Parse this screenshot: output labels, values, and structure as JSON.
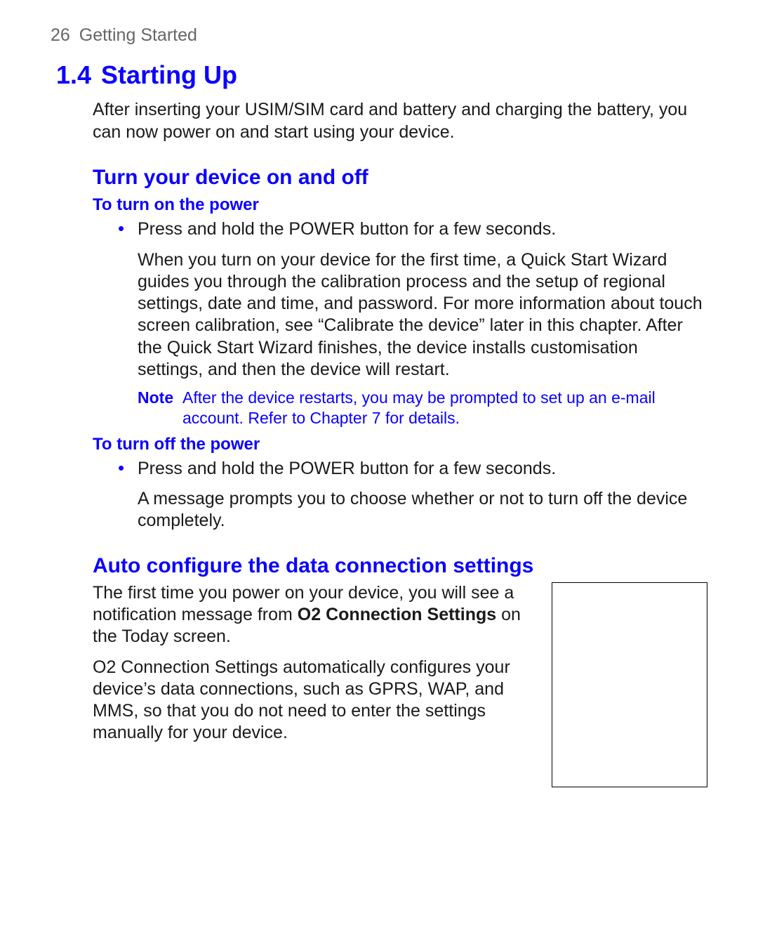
{
  "header": {
    "page_number": "26",
    "chapter": "Getting Started"
  },
  "section": {
    "number": "1.4",
    "title": "Starting Up",
    "intro": "After inserting your USIM/SIM card and battery and charging the battery, you can now power on and start using your device."
  },
  "sub1": {
    "title": "Turn your device on and off",
    "on": {
      "title": "To turn on the power",
      "bullet": "Press and hold the POWER button for a few seconds.",
      "para": "When you turn on your device for the first time, a Quick Start Wizard guides you through the calibration process and the setup of regional settings, date and time, and password. For more information about touch screen calibration, see “Calibrate the device” later in this chapter. After the Quick Start Wizard finishes, the device installs customisation settings, and then the device will restart."
    },
    "note": {
      "label": "Note",
      "text": "After the device restarts, you may be prompted to set up an e-mail account. Refer to Chapter 7 for details."
    },
    "off": {
      "title": "To turn off the power",
      "bullet": "Press and hold the POWER button for a few seconds.",
      "para": "A message prompts you to choose whether or not to turn off the device completely."
    }
  },
  "sub2": {
    "title": "Auto configure the data connection settings",
    "p1_a": "The first time you power on your device, you will see a notification message from ",
    "p1_bold": "O2 Connection Settings",
    "p1_b": " on the Today screen.",
    "p2": "O2 Connection Settings automatically configures your device’s data connections, such as GPRS, WAP, and MMS, so that you do not need to enter the settings manually for your device."
  }
}
